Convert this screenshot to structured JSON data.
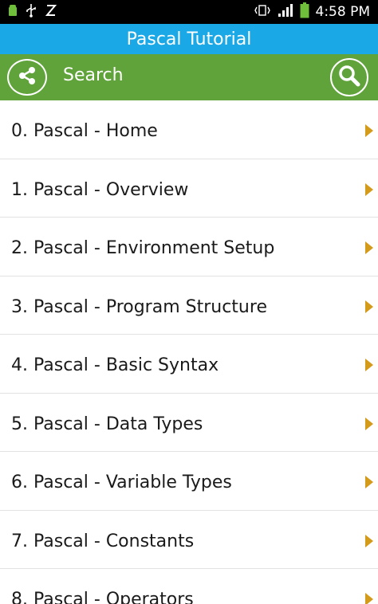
{
  "status_bar": {
    "time": "4:58 PM",
    "icons": [
      "android-notification-icon",
      "usb-icon",
      "sync-icon",
      "vibrate-icon",
      "signal-icon",
      "battery-icon"
    ]
  },
  "app": {
    "title": "Pascal Tutorial"
  },
  "search_bar": {
    "label": "Search",
    "share_icon": "share-icon",
    "search_icon": "search-icon"
  },
  "colors": {
    "title_bar": "#1aa9e6",
    "search_bar": "#5fa33a",
    "chevron": "#d49a1a"
  },
  "lessons": [
    {
      "label": "0. Pascal - Home"
    },
    {
      "label": "1. Pascal - Overview"
    },
    {
      "label": "2. Pascal - Environment Setup"
    },
    {
      "label": "3. Pascal - Program Structure"
    },
    {
      "label": "4. Pascal - Basic Syntax"
    },
    {
      "label": "5. Pascal - Data Types"
    },
    {
      "label": "6. Pascal - Variable Types"
    },
    {
      "label": "7. Pascal - Constants"
    },
    {
      "label": "8. Pascal - Operators"
    }
  ]
}
